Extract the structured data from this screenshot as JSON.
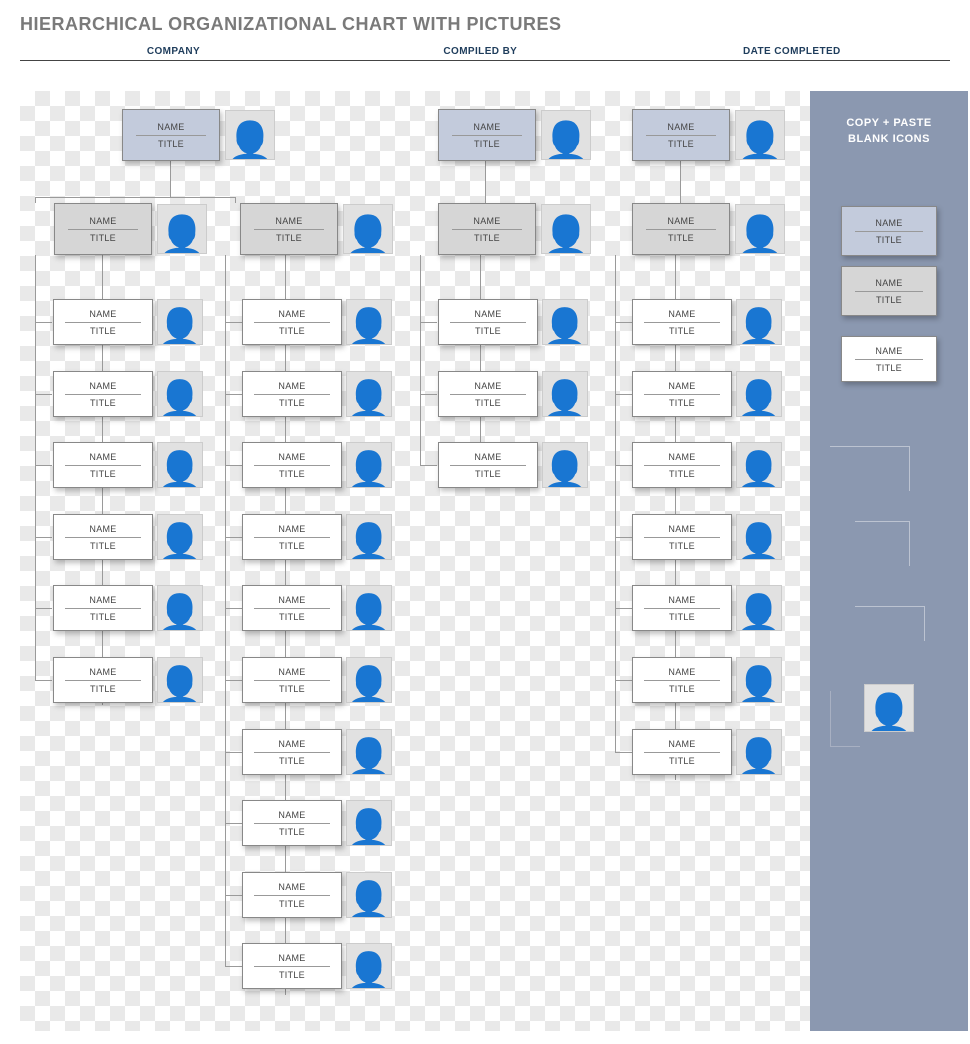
{
  "document": {
    "title": "HIERARCHICAL ORGANIZATIONAL CHART WITH PICTURES",
    "header_labels": {
      "company": "COMPANY",
      "compiled_by": "COMPILED BY",
      "date_completed": "DATE COMPLETED"
    }
  },
  "sidebar": {
    "title_line1": "COPY + PASTE",
    "title_line2": "BLANK ICONS",
    "samples": {
      "name": "NAME",
      "title": "TITLE"
    }
  },
  "labels": {
    "name": "NAME",
    "title": "TITLE"
  },
  "org": {
    "top_left": {
      "name": "NAME",
      "title": "TITLE",
      "mids": [
        {
          "name": "NAME",
          "title": "TITLE",
          "leaves": [
            {
              "name": "NAME",
              "title": "TITLE"
            },
            {
              "name": "NAME",
              "title": "TITLE"
            },
            {
              "name": "NAME",
              "title": "TITLE"
            },
            {
              "name": "NAME",
              "title": "TITLE"
            },
            {
              "name": "NAME",
              "title": "TITLE"
            },
            {
              "name": "NAME",
              "title": "TITLE"
            }
          ]
        },
        {
          "name": "NAME",
          "title": "TITLE",
          "leaves": [
            {
              "name": "NAME",
              "title": "TITLE"
            },
            {
              "name": "NAME",
              "title": "TITLE"
            },
            {
              "name": "NAME",
              "title": "TITLE"
            },
            {
              "name": "NAME",
              "title": "TITLE"
            },
            {
              "name": "NAME",
              "title": "TITLE"
            },
            {
              "name": "NAME",
              "title": "TITLE"
            },
            {
              "name": "NAME",
              "title": "TITLE"
            },
            {
              "name": "NAME",
              "title": "TITLE"
            },
            {
              "name": "NAME",
              "title": "TITLE"
            },
            {
              "name": "NAME",
              "title": "TITLE"
            }
          ]
        }
      ]
    },
    "top_mid": {
      "name": "NAME",
      "title": "TITLE",
      "mids": [
        {
          "name": "NAME",
          "title": "TITLE",
          "leaves": [
            {
              "name": "NAME",
              "title": "TITLE"
            },
            {
              "name": "NAME",
              "title": "TITLE"
            },
            {
              "name": "NAME",
              "title": "TITLE"
            }
          ]
        }
      ]
    },
    "top_right": {
      "name": "NAME",
      "title": "TITLE",
      "mids": [
        {
          "name": "NAME",
          "title": "TITLE",
          "leaves": [
            {
              "name": "NAME",
              "title": "TITLE"
            },
            {
              "name": "NAME",
              "title": "TITLE"
            },
            {
              "name": "NAME",
              "title": "TITLE"
            },
            {
              "name": "NAME",
              "title": "TITLE"
            },
            {
              "name": "NAME",
              "title": "TITLE"
            },
            {
              "name": "NAME",
              "title": "TITLE"
            },
            {
              "name": "NAME",
              "title": "TITLE"
            }
          ]
        }
      ]
    }
  }
}
